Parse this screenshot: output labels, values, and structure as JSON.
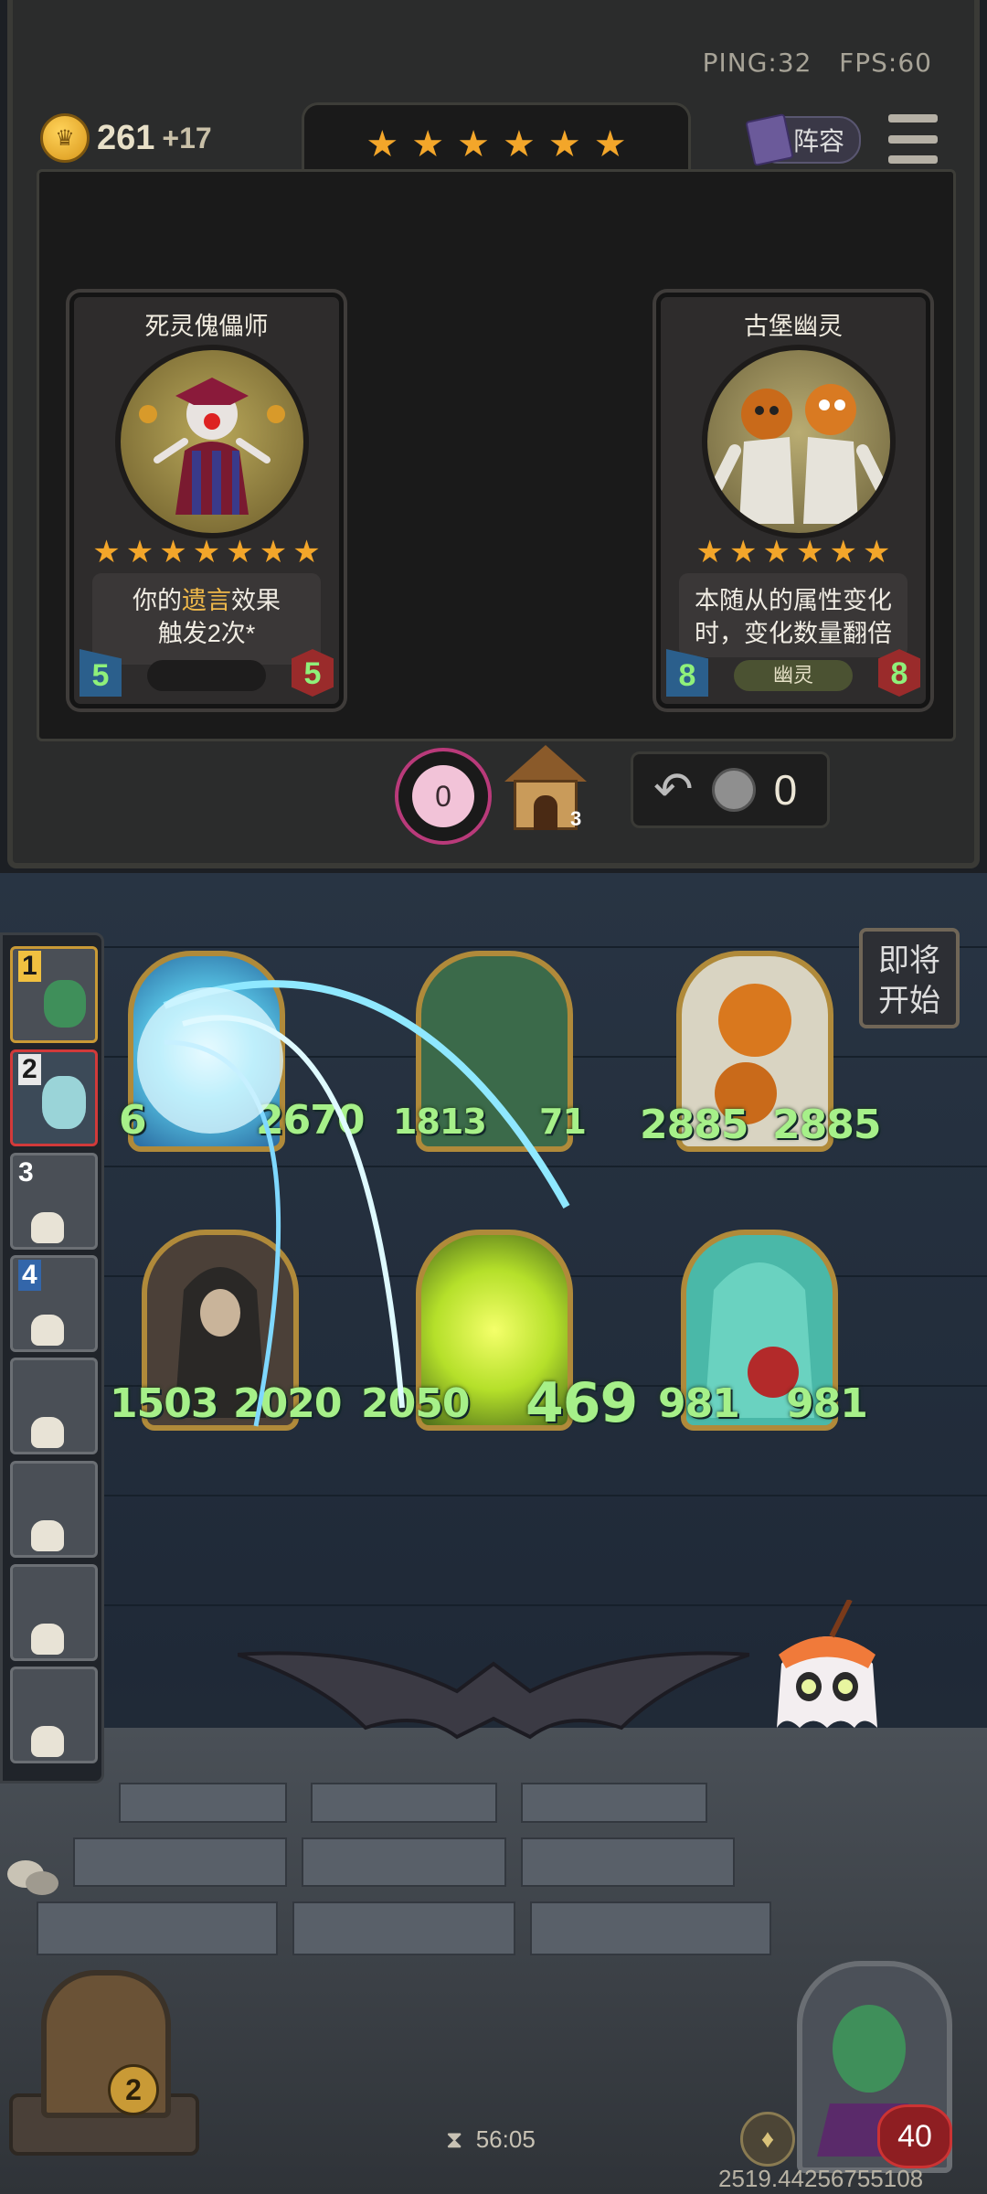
{
  "hud": {
    "ping": "PING:32",
    "fps": "FPS:60",
    "gold": "261",
    "gold_income": "+17",
    "lineup_label": "阵容",
    "star_count": 6
  },
  "shop": {
    "cards": [
      {
        "name": "死灵傀儡师",
        "stars": 7,
        "desc_line1_a": "你的",
        "desc_line1_keyword": "遗言",
        "desc_line1_b": "效果",
        "desc_line2": "触发2次*",
        "attack": "5",
        "health": "5",
        "tribe": "",
        "keyword_color": "#f0b94a"
      },
      {
        "name": "古堡幽灵",
        "stars": 6,
        "desc_line1": "本随从的属性变化",
        "desc_line2": "时，变化数量翻倍",
        "attack": "8",
        "health": "8",
        "tribe": "幽灵"
      }
    ],
    "freeze_count": "0",
    "tavern_tier": "3",
    "refresh_cost": "0"
  },
  "opponents": [
    {
      "rank": "1"
    },
    {
      "rank": "2"
    },
    {
      "rank": "3"
    },
    {
      "rank": "4"
    },
    {
      "rank": ""
    },
    {
      "rank": ""
    },
    {
      "rank": ""
    },
    {
      "rank": ""
    }
  ],
  "board": {
    "enemy_stats": [
      "6",
      "2670",
      "1813",
      "71",
      "2885",
      "2885"
    ],
    "friendly_stats": [
      "1503",
      "2020",
      "2050",
      "469",
      "981",
      "981"
    ]
  },
  "start_sign": {
    "line1": "即将",
    "line2": "开始"
  },
  "bottom": {
    "timer": "56:05",
    "coords": "2519.44256755108",
    "player_health": "40",
    "shop_level": "2"
  },
  "colors": {
    "accent_gold": "#f3a62a",
    "stat_green": "#a6f089",
    "health_red": "#8e1e22"
  }
}
